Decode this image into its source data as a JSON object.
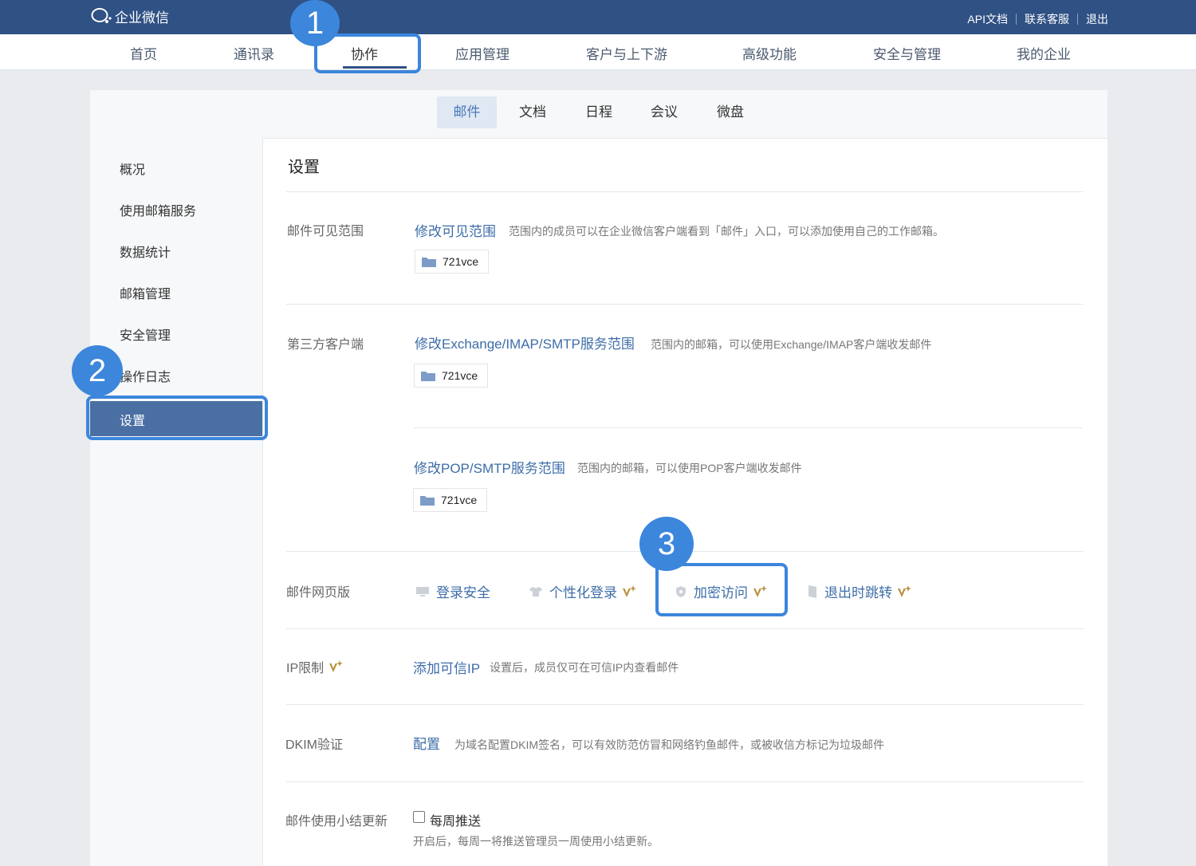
{
  "header": {
    "brand": "企业微信",
    "links": [
      "API文档",
      "联系客服",
      "退出"
    ]
  },
  "nav": {
    "items": [
      "首页",
      "通讯录",
      "协作",
      "应用管理",
      "客户与上下游",
      "高级功能",
      "安全与管理",
      "我的企业"
    ],
    "active": "协作"
  },
  "subtabs": {
    "items": [
      "邮件",
      "文档",
      "日程",
      "会议",
      "微盘"
    ],
    "active": "邮件"
  },
  "sidebar": {
    "items": [
      "概况",
      "使用邮箱服务",
      "数据统计",
      "邮箱管理",
      "安全管理",
      "操作日志",
      "设置"
    ],
    "active": "设置"
  },
  "content": {
    "title": "设置",
    "visibility": {
      "label": "邮件可见范围",
      "link": "修改可见范围",
      "desc": "范围内的成员可以在企业微信客户端看到「邮件」入口，可以添加使用自己的工作邮箱。",
      "chip": "721vce"
    },
    "third_party": {
      "label": "第三方客户端",
      "exchange_link": "修改Exchange/IMAP/SMTP服务范围",
      "exchange_desc": "范围内的邮箱，可以使用Exchange/IMAP客户端收发邮件",
      "exchange_chip": "721vce",
      "pop_link": "修改POP/SMTP服务范围",
      "pop_desc": "范围内的邮箱，可以使用POP客户端收发邮件",
      "pop_chip": "721vce"
    },
    "webmail": {
      "label": "邮件网页版",
      "login_security": "登录安全",
      "custom_login": "个性化登录",
      "encrypted_access": "加密访问",
      "logout_redirect": "退出时跳转"
    },
    "ip_limit": {
      "label": "IP限制",
      "link": "添加可信IP",
      "desc": "设置后，成员仅可在可信IP内查看邮件"
    },
    "dkim": {
      "label": "DKIM验证",
      "link": "配置",
      "desc": "为域名配置DKIM签名，可以有效防范仿冒和网络钓鱼邮件，或被收信方标记为垃圾邮件"
    },
    "summary": {
      "label": "邮件使用小结更新",
      "checkbox_label": "每周推送",
      "checked": false,
      "desc": "开启后，每周一将推送管理员一周使用小结更新。"
    }
  },
  "annotations": [
    "1",
    "2",
    "3"
  ],
  "colors": {
    "header_bg": "#2f5184",
    "link": "#3d6da8",
    "highlight": "#3c86dc",
    "sidebar_active": "#4a6fa3",
    "vip_gold": "#b8913d"
  },
  "icons": {
    "brand": "wecom-logo-icon",
    "folder": "folder-icon",
    "login_security": "monitor-icon",
    "custom_login": "shirt-icon",
    "encrypted_access": "shield-icon",
    "logout_redirect": "door-icon",
    "vip": "vip-badge-icon"
  }
}
